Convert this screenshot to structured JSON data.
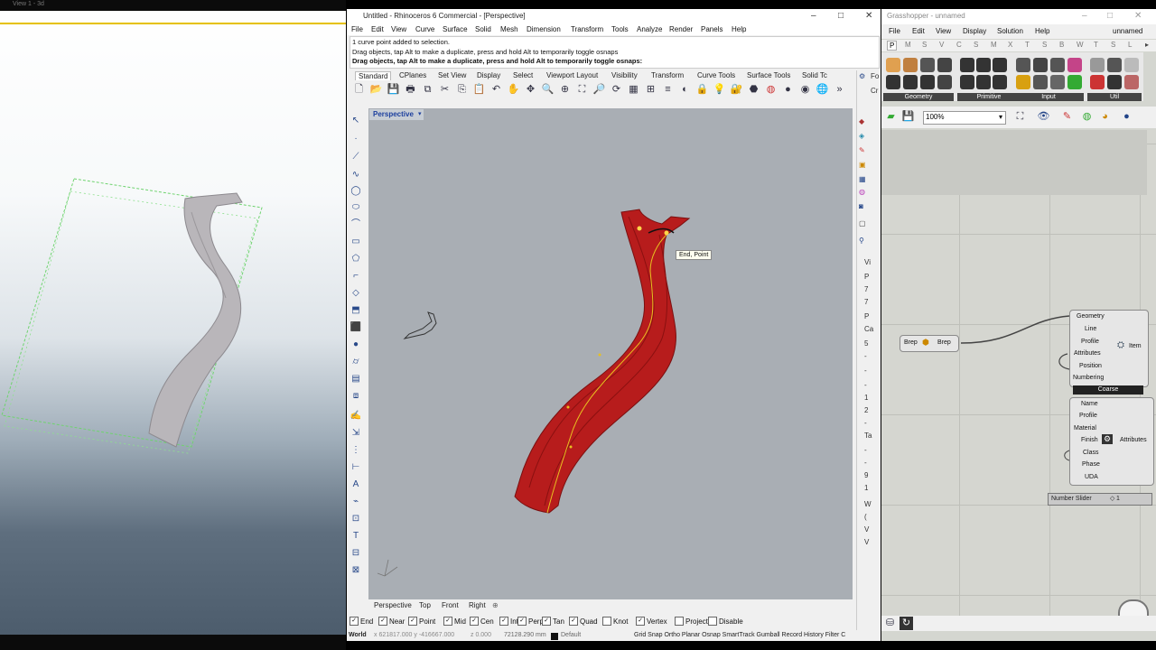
{
  "left_viewer": {
    "title": "View 1 - 3d"
  },
  "rhino": {
    "title": "Untitled - Rhinoceros 6 Commercial - [Perspective]",
    "menu": [
      "File",
      "Edit",
      "View",
      "Curve",
      "Surface",
      "Solid",
      "Mesh",
      "Dimension",
      "Transform",
      "Tools",
      "Analyze",
      "Render",
      "Panels",
      "Help"
    ],
    "command_lines": [
      "1 curve point added to selection.",
      "Drag objects, tap Alt to make a duplicate, press and hold Alt to temporarily toggle osnaps",
      "Drag objects, tap Alt to make a duplicate, press and hold Alt to temporarily toggle osnaps:"
    ],
    "tabs": [
      "Standard",
      "CPlanes",
      "Set View",
      "Display",
      "Select",
      "Viewport Layout",
      "Visibility",
      "Transform",
      "Curve Tools",
      "Surface Tools",
      "Solid Tc"
    ],
    "viewport_title": "Perspective",
    "tooltip": "End, Point",
    "viewport_tabs": [
      "Perspective",
      "Top",
      "Front",
      "Right"
    ],
    "osnaps": [
      {
        "label": "End",
        "checked": true
      },
      {
        "label": "Near",
        "checked": true
      },
      {
        "label": "Point",
        "checked": true
      },
      {
        "label": "Mid",
        "checked": true
      },
      {
        "label": "Cen",
        "checked": true
      },
      {
        "label": "Int",
        "checked": true
      },
      {
        "label": "Perp",
        "checked": true
      },
      {
        "label": "Tan",
        "checked": true
      },
      {
        "label": "Quad",
        "checked": true
      },
      {
        "label": "Knot",
        "checked": false
      },
      {
        "label": "Vertex",
        "checked": true
      },
      {
        "label": "Project",
        "checked": false
      },
      {
        "label": "Disable",
        "checked": false
      }
    ],
    "status": {
      "cplane": "World",
      "coords": "x 621817.000  y -416667.000",
      "z": "z 0.000",
      "units": "72128.290 mm",
      "layer": "Default",
      "toggles": "Grid Snap Ortho Planar Osnap SmartTrack Gumball Record History Filter C"
    },
    "side_panel_labels": [
      "Fo",
      "Cr",
      "Vi",
      "P",
      "7",
      "7",
      "P",
      "Ca",
      "5",
      "-",
      "-",
      "-",
      "1",
      "2",
      "-",
      "Ta",
      "-",
      "-",
      "9",
      "1",
      "W",
      "(",
      "V",
      "V"
    ]
  },
  "grasshopper": {
    "title": "Grasshopper - unnamed",
    "menu": [
      "File",
      "Edit",
      "View",
      "Display",
      "Solution",
      "Help"
    ],
    "doc_name": "unnamed",
    "tabs": [
      "P",
      "M",
      "S",
      "V",
      "C",
      "S",
      "M",
      "X",
      "T",
      "S",
      "B",
      "W",
      "T",
      "S",
      "L"
    ],
    "groups": [
      "Geometry",
      "Primitive",
      "Input",
      "Util"
    ],
    "zoom": "100%",
    "brep_node": {
      "input": "Brep",
      "output": "Brep"
    },
    "param_node_1": {
      "inputs": [
        "Geometry",
        "Line",
        "Profile",
        "Attributes",
        "Position",
        "Numbering"
      ],
      "output": "Item",
      "footer": "Coarse"
    },
    "param_node_2": {
      "inputs": [
        "Name",
        "Profile",
        "Material",
        "Finish",
        "Class",
        "Phase",
        "UDA"
      ],
      "output": "Attributes"
    },
    "slider": {
      "label": "Number Slider",
      "value": "1"
    }
  }
}
